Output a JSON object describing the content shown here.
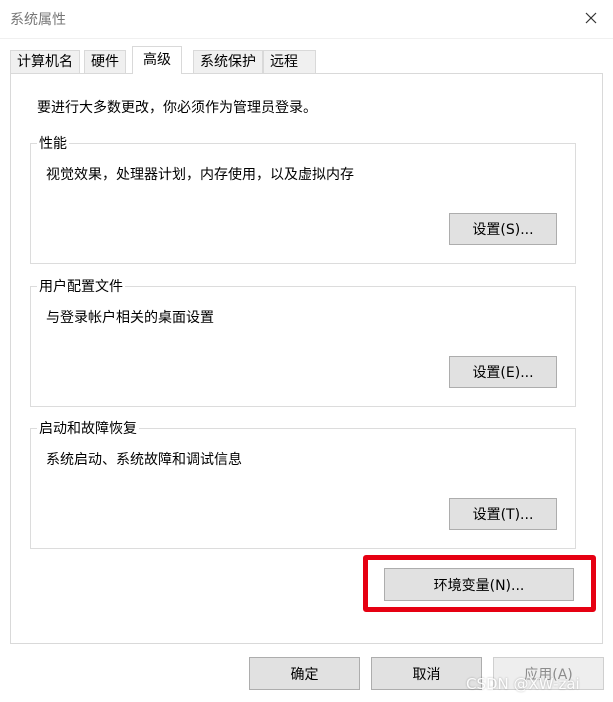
{
  "window": {
    "title": "系统属性",
    "close_icon": "×"
  },
  "tabs": [
    {
      "label": "计算机名"
    },
    {
      "label": "硬件"
    },
    {
      "label": "高级"
    },
    {
      "label": "系统保护"
    },
    {
      "label": "远程"
    }
  ],
  "info_text": "要进行大多数更改，你必须作为管理员登录。",
  "groups": [
    {
      "title": "性能",
      "description": "视觉效果，处理器计划，内存使用，以及虚拟内存",
      "button": "设置(S)..."
    },
    {
      "title": "用户配置文件",
      "description": "与登录帐户相关的桌面设置",
      "button": "设置(E)..."
    },
    {
      "title": "启动和故障恢复",
      "description": "系统启动、系统故障和调试信息",
      "button": "设置(T)..."
    }
  ],
  "env_button": "环境变量(N)...",
  "footer": {
    "ok": "确定",
    "cancel": "取消",
    "apply": "应用(A)"
  },
  "watermark": "CSDN @XW-zai",
  "colors": {
    "highlight": "#e60012",
    "button_bg": "#e1e1e1",
    "border": "#d9d9d9"
  }
}
